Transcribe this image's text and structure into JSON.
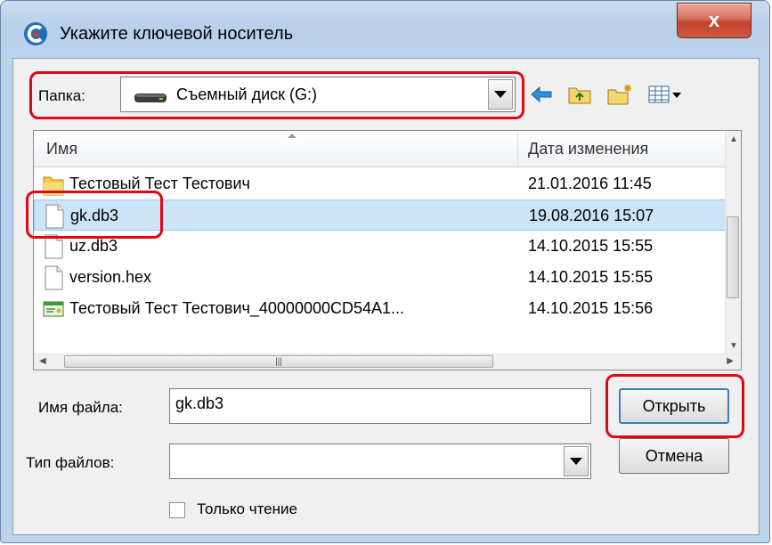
{
  "window": {
    "title": "Укажите ключевой носитель",
    "close_glyph": "x"
  },
  "toolbar": {
    "folder_label": "Папка:",
    "folder_value": "Съемный диск (G:)",
    "icons": [
      "back-arrow-icon",
      "up-folder-icon",
      "new-folder-icon",
      "view-menu-icon"
    ]
  },
  "file_list": {
    "columns": [
      {
        "label": "Имя"
      },
      {
        "label": "Дата изменения"
      }
    ],
    "rows": [
      {
        "name": "Тестовый Тест Тестович",
        "date": "21.01.2016 11:45",
        "icon": "folder-icon",
        "selected": false
      },
      {
        "name": "gk.db3",
        "date": "19.08.2016 15:07",
        "icon": "file-icon",
        "selected": true
      },
      {
        "name": "uz.db3",
        "date": "14.10.2015 15:55",
        "icon": "file-icon",
        "selected": false
      },
      {
        "name": "version.hex",
        "date": "14.10.2015 15:55",
        "icon": "file-icon",
        "selected": false
      },
      {
        "name": "Тестовый Тест Тестович_40000000CD54A1...",
        "date": "14.10.2015 15:56",
        "icon": "certificate-icon",
        "selected": false
      }
    ]
  },
  "form": {
    "filename_label": "Имя файла:",
    "filename_value": "gk.db3",
    "filetype_label": "Тип файлов:",
    "filetype_value": "",
    "readonly_label": "Только чтение",
    "readonly_checked": false,
    "open_button": "Открыть",
    "cancel_button": "Отмена"
  },
  "colors": {
    "highlight": "#e30613",
    "selection": "#cce4f7"
  }
}
